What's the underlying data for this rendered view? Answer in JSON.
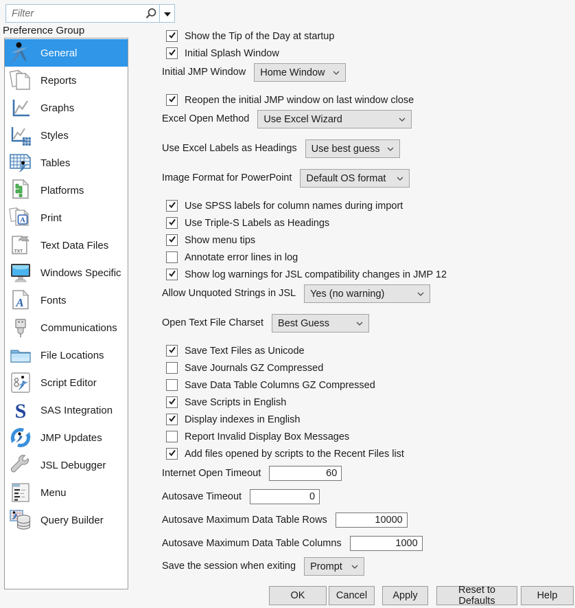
{
  "colors": {
    "selection": "#2f96e8"
  },
  "filter": {
    "placeholder": "Filter"
  },
  "sidebar": {
    "label": "Preference Group",
    "items": [
      {
        "label": "General",
        "icon": "jmp-person-icon",
        "selected": true
      },
      {
        "label": "Reports",
        "icon": "documents-icon"
      },
      {
        "label": "Graphs",
        "icon": "line-chart-icon"
      },
      {
        "label": "Styles",
        "icon": "chart-grid-icon"
      },
      {
        "label": "Tables",
        "icon": "spreadsheet-icon"
      },
      {
        "label": "Platforms",
        "icon": "bar-chart-page-icon"
      },
      {
        "label": "Print",
        "icon": "print-pages-icon"
      },
      {
        "label": "Text Data Files",
        "icon": "txt-file-icon"
      },
      {
        "label": "Windows Specific",
        "icon": "monitor-icon"
      },
      {
        "label": "Fonts",
        "icon": "font-page-icon"
      },
      {
        "label": "Communications",
        "icon": "usb-plug-icon"
      },
      {
        "label": "File Locations",
        "icon": "folder-icon"
      },
      {
        "label": "Script Editor",
        "icon": "script-page-icon"
      },
      {
        "label": "SAS Integration",
        "icon": "sas-s-icon"
      },
      {
        "label": "JMP Updates",
        "icon": "refresh-arrows-icon"
      },
      {
        "label": "JSL Debugger",
        "icon": "wrench-icon"
      },
      {
        "label": "Menu",
        "icon": "menu-page-icon"
      },
      {
        "label": "Query Builder",
        "icon": "database-grid-icon"
      }
    ]
  },
  "main": {
    "rows": [
      {
        "id": "tip_of_day",
        "type": "checkbox",
        "checked": true,
        "label": "Show the Tip of the Day at startup"
      },
      {
        "id": "initial_splash",
        "type": "checkbox",
        "checked": true,
        "label": "Initial Splash Window"
      },
      {
        "id": "initial_jmp_window",
        "type": "dropdown",
        "label": "Initial JMP Window",
        "value": "Home Window"
      },
      {
        "id": "reopen_initial",
        "type": "checkbox",
        "checked": true,
        "label": "Reopen the initial JMP window on last window close"
      },
      {
        "id": "excel_open_method",
        "type": "dropdown",
        "label": "Excel Open Method",
        "value": "Use Excel Wizard"
      },
      {
        "id": "excel_labels",
        "type": "dropdown",
        "label": "Use Excel Labels as Headings",
        "value": "Use best guess"
      },
      {
        "id": "ppt_image_format",
        "type": "dropdown",
        "label": "Image Format for PowerPoint",
        "value": "Default OS format"
      },
      {
        "id": "spss_labels",
        "type": "checkbox",
        "checked": true,
        "label": "Use SPSS labels for column names during import"
      },
      {
        "id": "triple_s_labels",
        "type": "checkbox",
        "checked": true,
        "label": "Use Triple-S Labels as Headings"
      },
      {
        "id": "show_menu_tips",
        "type": "checkbox",
        "checked": true,
        "label": "Show menu tips"
      },
      {
        "id": "annotate_errors",
        "type": "checkbox",
        "checked": false,
        "label": "Annotate error lines in log"
      },
      {
        "id": "jsl_compat_warnings",
        "type": "checkbox",
        "checked": true,
        "label": "Show log warnings for JSL compatibility changes in JMP 12"
      },
      {
        "id": "unquoted_strings",
        "type": "dropdown",
        "label": "Allow Unquoted Strings in JSL",
        "value": "Yes (no warning)"
      },
      {
        "id": "text_charset",
        "type": "dropdown",
        "label": "Open Text File Charset",
        "value": "Best Guess"
      },
      {
        "id": "save_unicode",
        "type": "checkbox",
        "checked": true,
        "label": "Save Text Files as Unicode"
      },
      {
        "id": "journals_gz",
        "type": "checkbox",
        "checked": false,
        "label": "Save Journals GZ Compressed"
      },
      {
        "id": "columns_gz",
        "type": "checkbox",
        "checked": false,
        "label": "Save Data Table Columns GZ Compressed"
      },
      {
        "id": "scripts_english",
        "type": "checkbox",
        "checked": true,
        "label": "Save Scripts in English"
      },
      {
        "id": "indexes_english",
        "type": "checkbox",
        "checked": true,
        "label": "Display indexes in English"
      },
      {
        "id": "invalid_display_box",
        "type": "checkbox",
        "checked": false,
        "label": "Report Invalid Display Box Messages"
      },
      {
        "id": "recent_files",
        "type": "checkbox",
        "checked": true,
        "label": "Add files opened by scripts to the Recent Files list"
      },
      {
        "id": "internet_timeout",
        "type": "number",
        "label": "Internet Open Timeout",
        "value": "60"
      },
      {
        "id": "autosave_timeout",
        "type": "number",
        "label": "Autosave Timeout",
        "value": "0"
      },
      {
        "id": "autosave_rows",
        "type": "number",
        "label": "Autosave Maximum Data Table Rows",
        "value": "10000"
      },
      {
        "id": "autosave_cols",
        "type": "number",
        "label": "Autosave Maximum Data Table Columns",
        "value": "1000"
      },
      {
        "id": "save_session",
        "type": "dropdown",
        "label": "Save the session when exiting",
        "value": "Prompt"
      }
    ]
  },
  "footer": {
    "buttons": [
      {
        "id": "ok",
        "label": "OK"
      },
      {
        "id": "cancel",
        "label": "Cancel"
      },
      {
        "id": "apply",
        "label": "Apply"
      },
      {
        "id": "reset",
        "label": "Reset to Defaults"
      },
      {
        "id": "help",
        "label": "Help"
      }
    ]
  }
}
